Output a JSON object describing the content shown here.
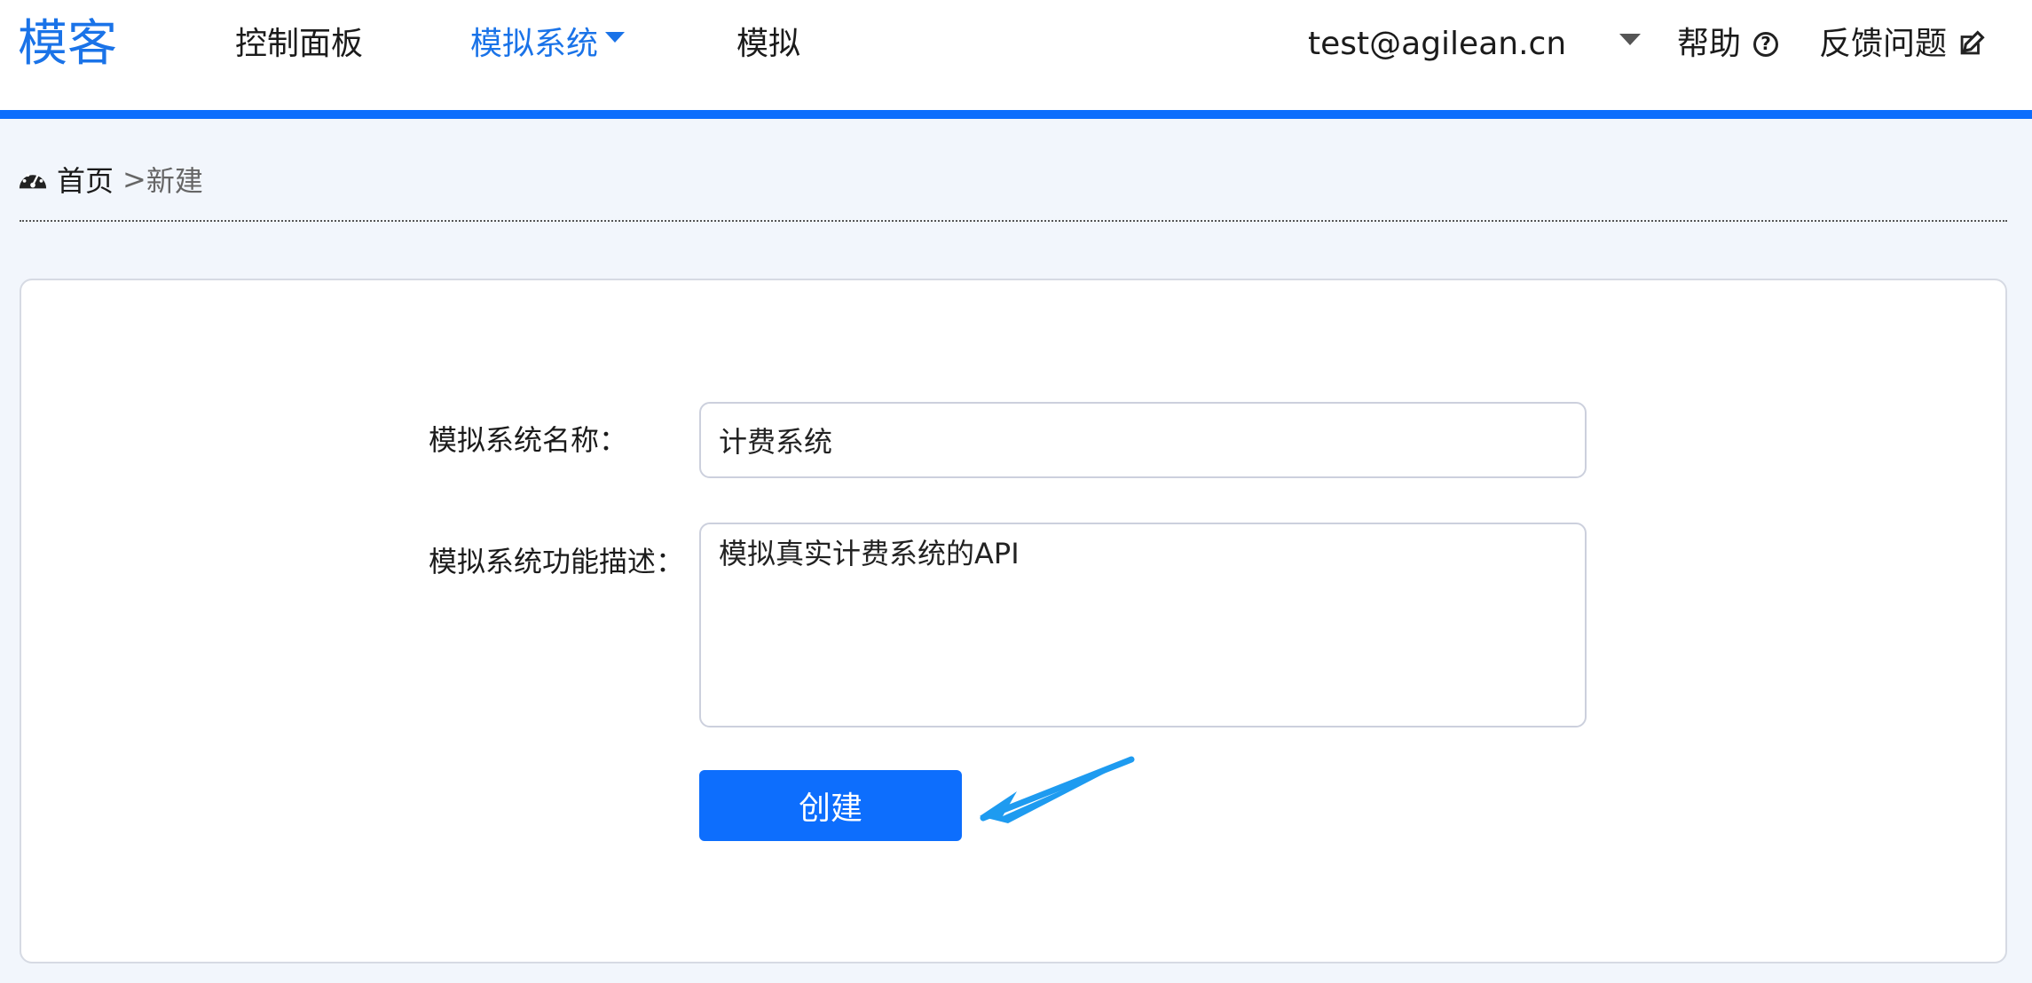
{
  "header": {
    "brand": "模客",
    "nav": [
      {
        "label": "控制面板"
      },
      {
        "label": "模拟系统"
      },
      {
        "label": "模拟"
      }
    ],
    "user_email": "test@agilean.cn",
    "help_label": "帮助",
    "feedback_label": "反馈问题",
    "accent_color": "#0d6efd"
  },
  "breadcrumb": {
    "home": "首页",
    "separator": ">",
    "current": "新建"
  },
  "form": {
    "name_label": "模拟系统名称：",
    "name_value": "计费系统",
    "desc_label": "模拟系统功能描述：",
    "desc_value": "模拟真实计费系统的API",
    "submit_label": "创建"
  },
  "icons": [
    "dashboard-icon",
    "chevron-down-icon",
    "help-circle-icon",
    "edit-icon",
    "annotation-arrow"
  ]
}
